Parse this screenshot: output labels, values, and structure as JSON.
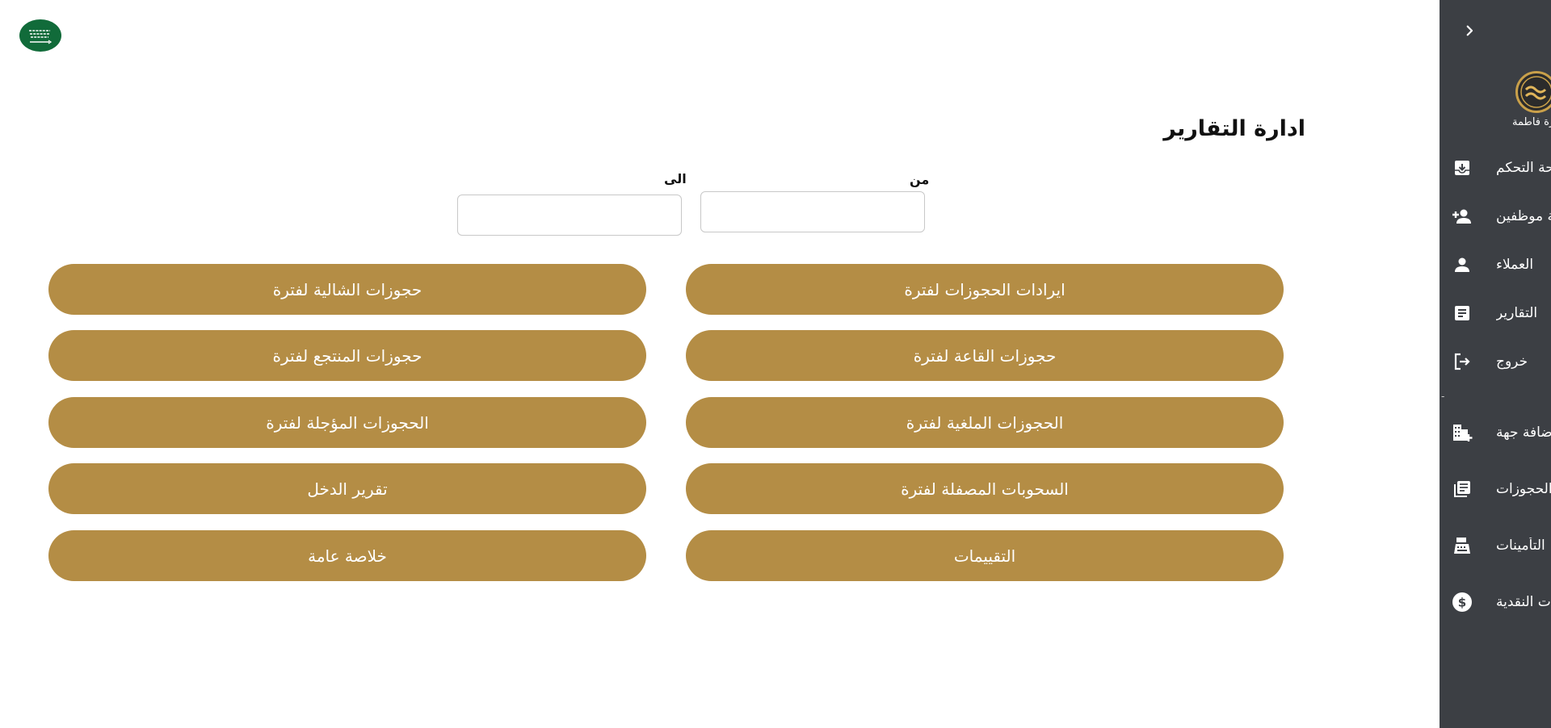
{
  "header": {
    "flag_icon": "saudi-flag-icon"
  },
  "sidebar": {
    "background": "#3c3f44",
    "toggle_icon": "chevron-right-icon",
    "logo_caption": "إدارة فاطمة",
    "items": [
      {
        "label": "لوحة التحكم",
        "icon": "archive-icon"
      },
      {
        "label": "إضافة موظفين",
        "icon": "person-add-icon"
      },
      {
        "label": "العملاء",
        "icon": "person-icon"
      },
      {
        "label": "التقارير",
        "icon": "article-icon"
      },
      {
        "label": "خروج",
        "icon": "logout-icon"
      },
      {
        "label": "إضافة جهة",
        "icon": "add-business-icon"
      },
      {
        "label": "الحجوزات",
        "icon": "library-books-icon"
      },
      {
        "label": "التأمينات",
        "icon": "cash-register-icon"
      },
      {
        "label": "الدفعات النقدية",
        "icon": "dollar-circle-icon"
      }
    ],
    "separator": "-"
  },
  "main": {
    "title": "ادارة التقارير",
    "date_from": {
      "label": "من",
      "value": ""
    },
    "date_to": {
      "label": "الى",
      "value": ""
    },
    "accent": "#b48d45",
    "buttons_right": [
      "ايرادات الحجوزات لفترة",
      "حجوزات القاعة لفترة",
      "الحجوزات الملغية لفترة",
      "السحوبات المصفلة لفترة",
      "التقييمات"
    ],
    "buttons_left": [
      "حجوزات الشالية لفترة",
      "حجوزات المنتجع لفترة",
      "الحجوزات المؤجلة لفترة",
      "تقرير الدخل",
      "خلاصة عامة"
    ]
  }
}
